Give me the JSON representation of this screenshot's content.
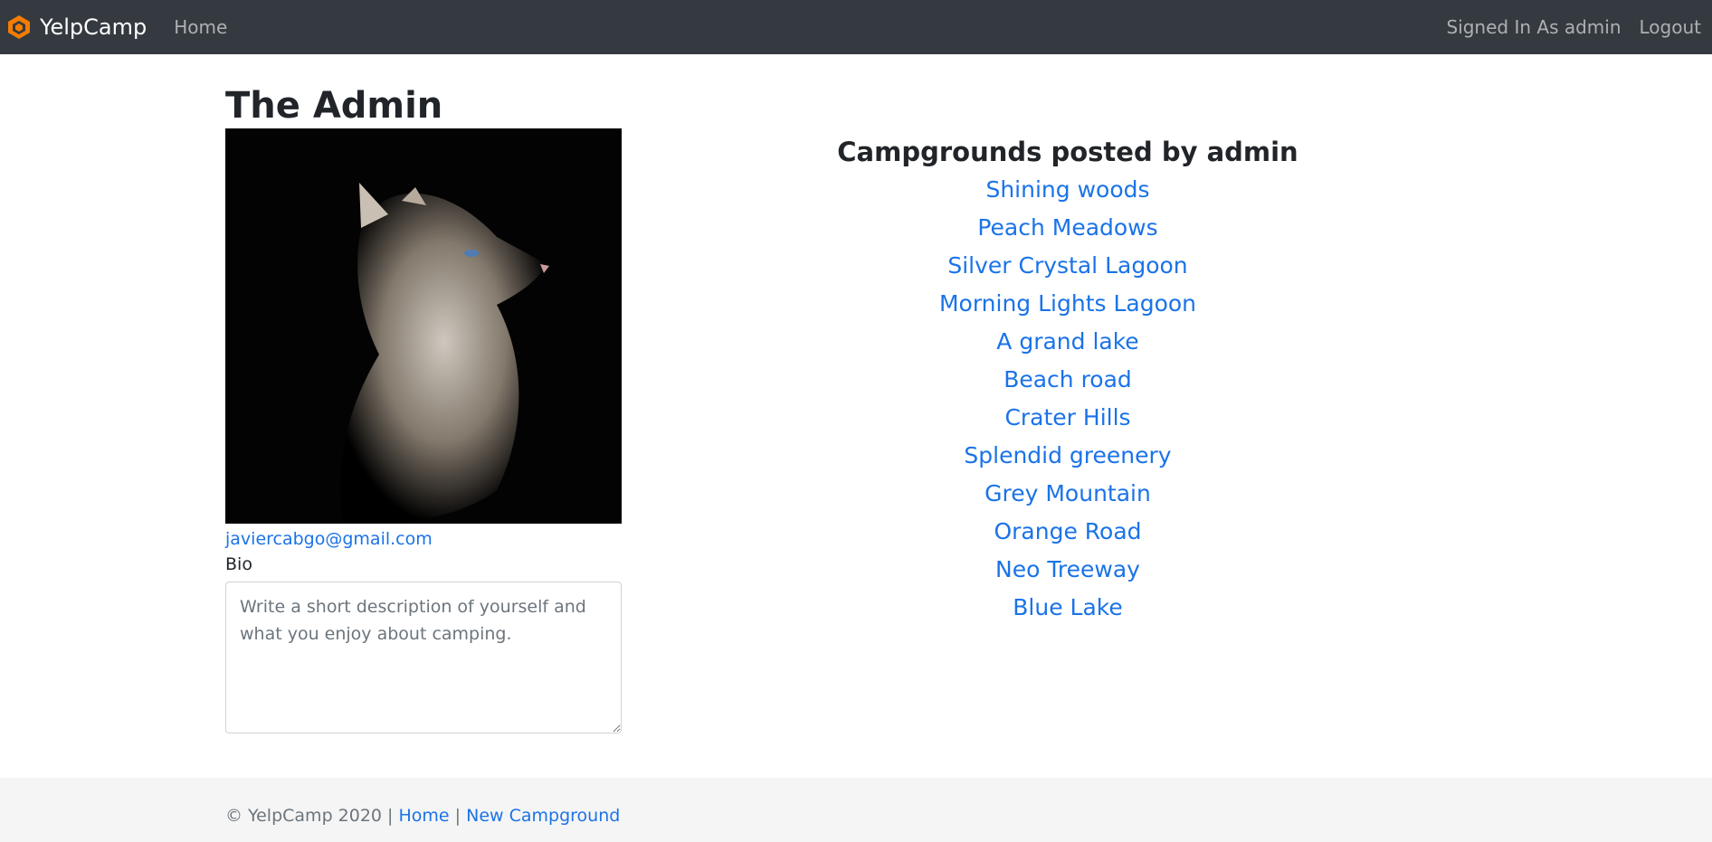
{
  "navbar": {
    "brand": "YelpCamp",
    "home": "Home",
    "signed_in": "Signed In As admin",
    "logout": "Logout"
  },
  "profile": {
    "title": "The Admin",
    "email": "javiercabgo@gmail.com",
    "bio_label": "Bio",
    "bio_placeholder": "Write a short description of yourself and what you enjoy about camping."
  },
  "campgrounds": {
    "heading": "Campgrounds posted by admin",
    "items": [
      "Shining woods",
      "Peach Meadows",
      "Silver Crystal Lagoon",
      "Morning Lights Lagoon",
      "A grand lake",
      "Beach road",
      "Crater Hills",
      "Splendid greenery",
      "Grey Mountain",
      "Orange Road",
      "Neo Treeway",
      "Blue Lake"
    ]
  },
  "footer": {
    "copyright": "© YelpCamp 2020 |",
    "separator": "|",
    "home": "Home",
    "new_campground": "New Campground"
  },
  "colors": {
    "navbar_bg": "#343a40",
    "link": "#1a73e8",
    "brand_icon": "#f57c00",
    "footer_bg": "#f5f5f5"
  },
  "icons": {
    "brand_icon": "hexagon-logo-icon"
  }
}
